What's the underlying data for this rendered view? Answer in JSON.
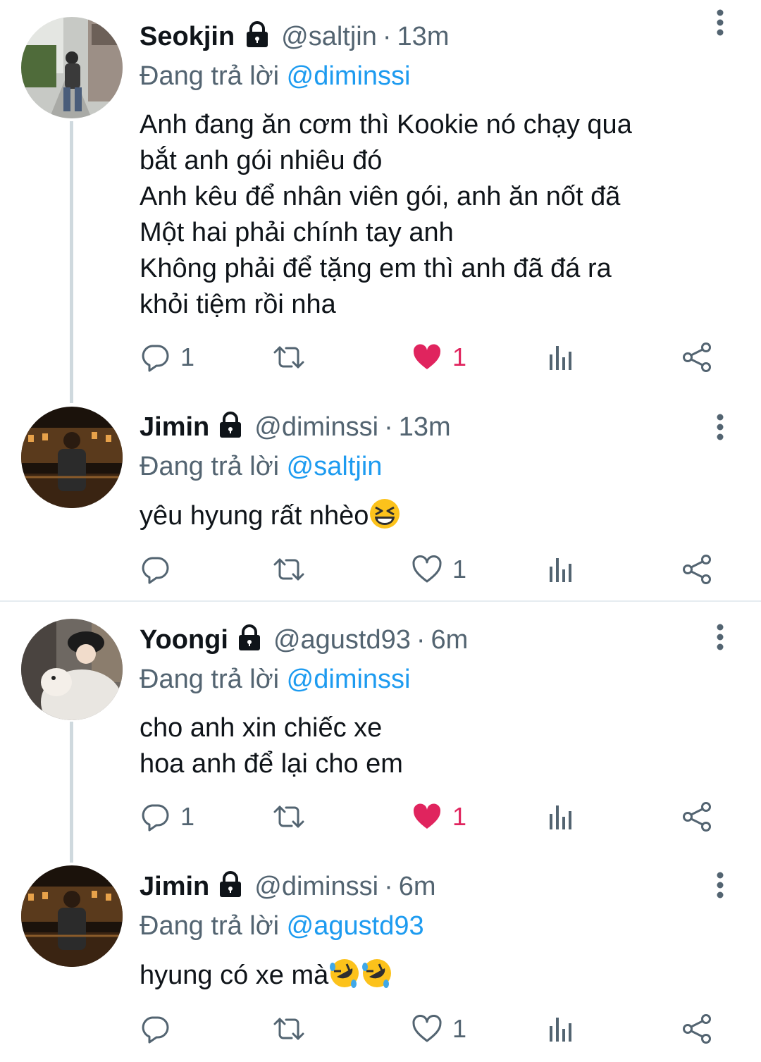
{
  "reply_prefix": "Đang trả lời",
  "tweets": [
    {
      "name": "Seokjin",
      "handle": "@saltjin",
      "dot": "·",
      "time": "13m",
      "reply_to": "@diminssi",
      "text": "Anh đang ăn cơm thì Kookie nó chạy qua\nbắt anh gói nhiêu đó\nAnh kêu để nhân viên gói, anh ăn nốt đã\nMột hai phải chính tay anh\nKhông phải để tặng em thì anh đã đá ra\nkhỏi tiệm rồi nha",
      "reply_count": "1",
      "retweet_count": "",
      "like_count": "1",
      "liked": true
    },
    {
      "name": "Jimin",
      "handle": "@diminssi",
      "dot": "·",
      "time": "13m",
      "reply_to": "@saltjin",
      "text": "yêu hyung rất nhèo",
      "reply_count": "",
      "retweet_count": "",
      "like_count": "1",
      "liked": false
    },
    {
      "name": "Yoongi",
      "handle": "@agustd93",
      "dot": "·",
      "time": "6m",
      "reply_to": "@diminssi",
      "text": "cho anh xin chiếc xe\nhoa anh để lại cho em",
      "reply_count": "1",
      "retweet_count": "",
      "like_count": "1",
      "liked": true
    },
    {
      "name": "Jimin",
      "handle": "@diminssi",
      "dot": "·",
      "time": "6m",
      "reply_to": "@agustd93",
      "text": "hyung có xe mà",
      "reply_count": "",
      "retweet_count": "",
      "like_count": "1",
      "liked": false
    }
  ],
  "colors": {
    "accent": "#1d9bf0",
    "like": "#e0245e",
    "secondary_text": "#536471",
    "thread_line": "#cfd9de"
  },
  "icons": {
    "lock": "lock-icon",
    "more": "more-vertical-icon",
    "reply": "reply-icon",
    "retweet": "retweet-icon",
    "like": "heart-icon",
    "analytics": "analytics-icon",
    "share": "share-icon",
    "emoji_laugh": "grinning-squinting-face-emoji",
    "emoji_rofl": "rolling-on-floor-laughing-emoji"
  }
}
